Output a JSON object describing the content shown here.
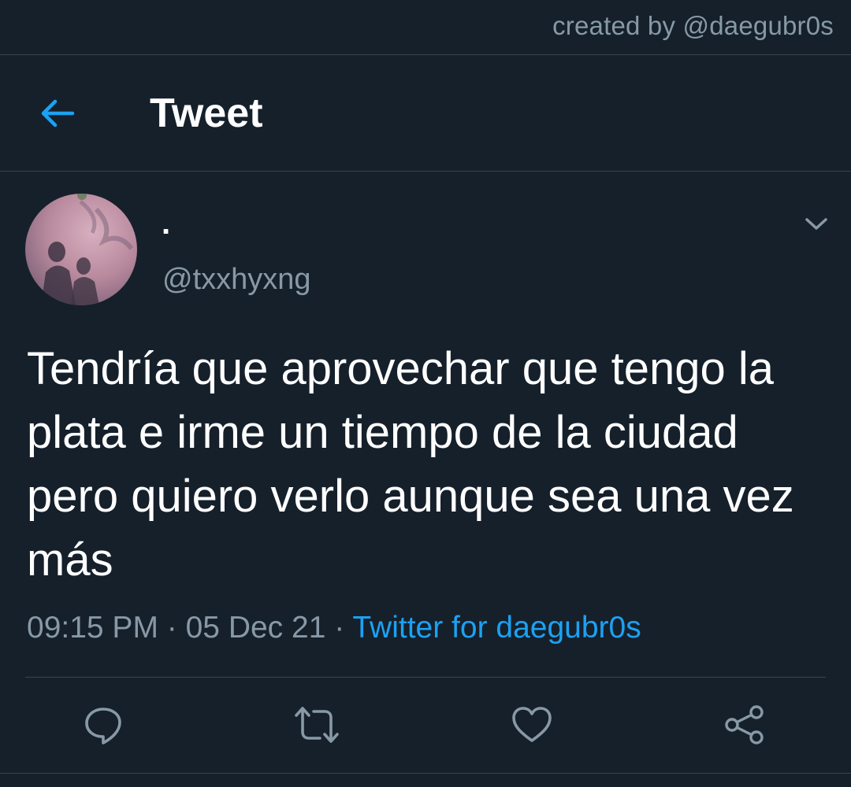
{
  "credit": "created by @daegubr0s",
  "header": {
    "back_icon": "arrow-left-icon",
    "title": "Tweet"
  },
  "tweet": {
    "display_name": ".",
    "handle": "@txxhyxng",
    "text": "Tendría que aprovechar que tengo la plata e irme un tiempo de la ciudad pero quiero verlo aunque sea una vez más",
    "time": "09:15 PM",
    "separator1": " · ",
    "date": "05 Dec 21",
    "separator2": " · ",
    "source": "Twitter for daegubr0s"
  },
  "actions": [
    {
      "name": "reply",
      "icon": "reply-icon"
    },
    {
      "name": "retweet",
      "icon": "retweet-icon"
    },
    {
      "name": "like",
      "icon": "heart-icon"
    },
    {
      "name": "share",
      "icon": "share-icon"
    }
  ],
  "colors": {
    "background": "#15202b",
    "accent": "#1da1f2",
    "muted": "#8899a6",
    "border": "#38444d",
    "text": "#ffffff"
  }
}
